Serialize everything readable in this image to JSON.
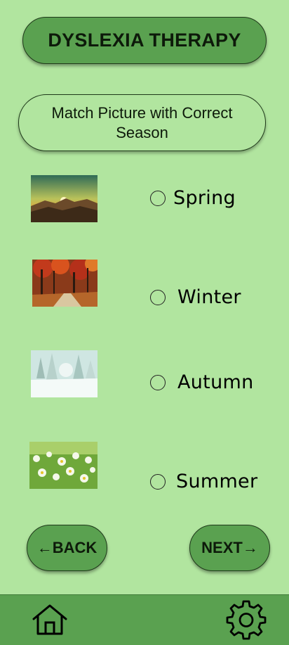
{
  "header": {
    "title": "DYSLEXIA THERAPY"
  },
  "instruction": {
    "text": "Match Picture with Correct Season"
  },
  "images": [
    {
      "name": "sunrise-mountain-image",
      "description": "sunrise over mountains"
    },
    {
      "name": "autumn-forest-image",
      "description": "autumn forest path"
    },
    {
      "name": "snowy-forest-image",
      "description": "snowy winter forest"
    },
    {
      "name": "daisy-field-image",
      "description": "field of daisies"
    }
  ],
  "options": [
    {
      "label": "Spring",
      "selected": false
    },
    {
      "label": "Winter",
      "selected": false
    },
    {
      "label": "Autumn",
      "selected": false
    },
    {
      "label": "Summer",
      "selected": false
    }
  ],
  "nav": {
    "back_label": "←BACK",
    "next_label": "NEXT→"
  },
  "bottom_bar": {
    "icons": [
      "home-icon",
      "gear-icon"
    ]
  },
  "colors": {
    "background": "#b1e59f",
    "accent": "#5aa150",
    "text": "#0d1a0a"
  }
}
